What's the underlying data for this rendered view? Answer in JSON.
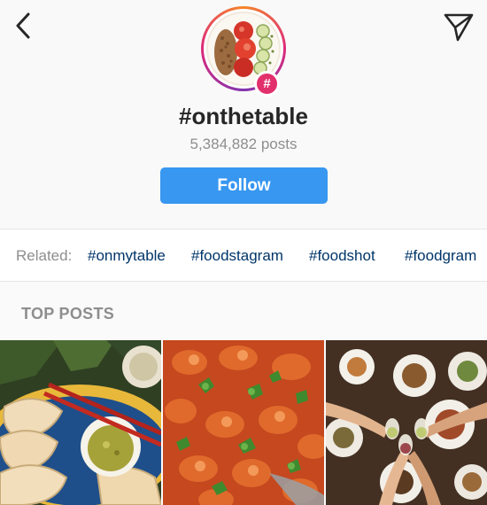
{
  "header": {
    "back_icon": "chevron-left-icon",
    "send_icon": "paper-plane-icon",
    "hashtag_badge": "#",
    "title": "#onthetable",
    "post_count": "5,384,882 posts",
    "follow_label": "Follow",
    "accent_color": "#3897f0",
    "badge_color": "#e1306c"
  },
  "related": {
    "label": "Related:",
    "tags": [
      "#onmytable",
      "#foodstagram",
      "#foodshot",
      "#foodgram"
    ]
  },
  "top_posts": {
    "label": "TOP POSTS",
    "posts": [
      {
        "description_icon": "dumplings-photo"
      },
      {
        "description_icon": "shrimp-curry-photo"
      },
      {
        "description_icon": "dinner-toast-photo"
      }
    ]
  }
}
